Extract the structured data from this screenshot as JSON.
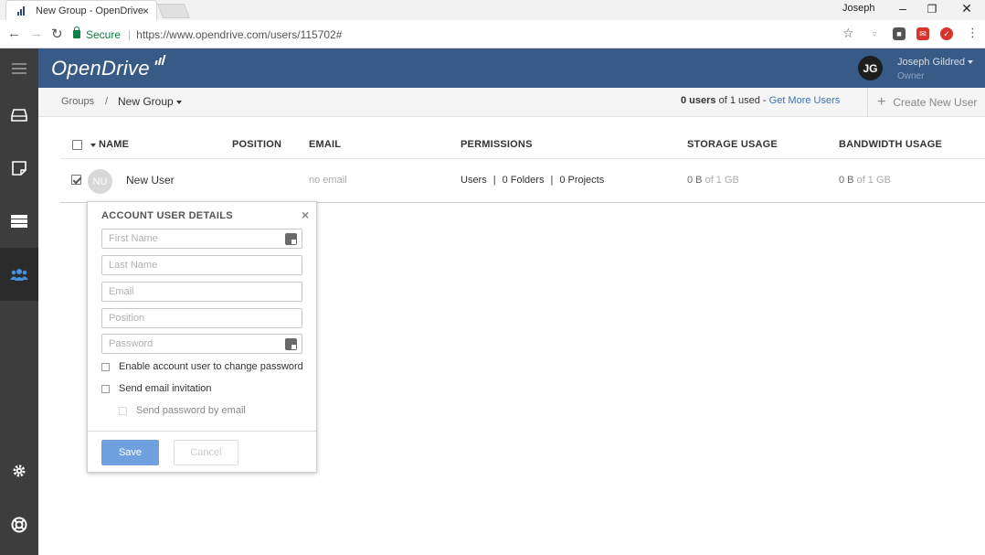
{
  "browser": {
    "tab_title": "New Group - OpenDrive",
    "tab_close": "×",
    "profile_name": "Joseph",
    "win_minimize": "–",
    "win_restore": "❐",
    "win_close": "✕",
    "secure_label": "Secure",
    "url": "https://www.opendrive.com/users/115702#"
  },
  "header": {
    "logo_text": "OpenDrive",
    "avatar_initials": "JG",
    "user_name": "Joseph Gildred",
    "user_role": "Owner"
  },
  "subheader": {
    "crumb_groups": "Groups",
    "crumb_separator": "/",
    "crumb_current": "New Group",
    "users_count": "0 users",
    "users_of": "of 1 used -",
    "get_more": "Get More Users",
    "create_user_plus": "+",
    "create_user": "Create New User"
  },
  "table": {
    "columns": {
      "name": "NAME",
      "position": "POSITION",
      "email": "EMAIL",
      "permissions": "PERMISSIONS",
      "storage": "STORAGE USAGE",
      "bandwidth": "BANDWIDTH USAGE"
    },
    "row": {
      "initials": "NU",
      "name": "New User",
      "email": "no email",
      "perm_users": "Users",
      "perm_sep": "|",
      "perm_folders": "0 Folders",
      "perm_projects": "0 Projects",
      "storage_used": "0 B",
      "storage_of": "of 1 GB",
      "bandwidth_used": "0 B",
      "bandwidth_of": "of 1 GB"
    }
  },
  "popup": {
    "title": "ACCOUNT USER DETAILS",
    "close": "×",
    "first_name_placeholder": "First Name",
    "last_name_placeholder": "Last Name",
    "email_placeholder": "Email",
    "position_placeholder": "Position",
    "password_placeholder": "Password",
    "opt_change_password": "Enable account user to change password",
    "opt_send_invitation": "Send email invitation",
    "opt_send_password": "Send password by email",
    "save": "Save",
    "cancel": "Cancel"
  },
  "colors": {
    "header_bg": "#375a87",
    "sidebar_bg": "#3d3d3d",
    "accent_blue": "#3d72b4",
    "save_button": "#6fa0e0",
    "secure_green": "#0b8043"
  },
  "icons": {
    "sidebar": [
      "hamburger-icon",
      "drive-icon",
      "notes-icon",
      "server-icon",
      "users-icon",
      "gear-icon",
      "help-lifebuoy-icon"
    ]
  }
}
